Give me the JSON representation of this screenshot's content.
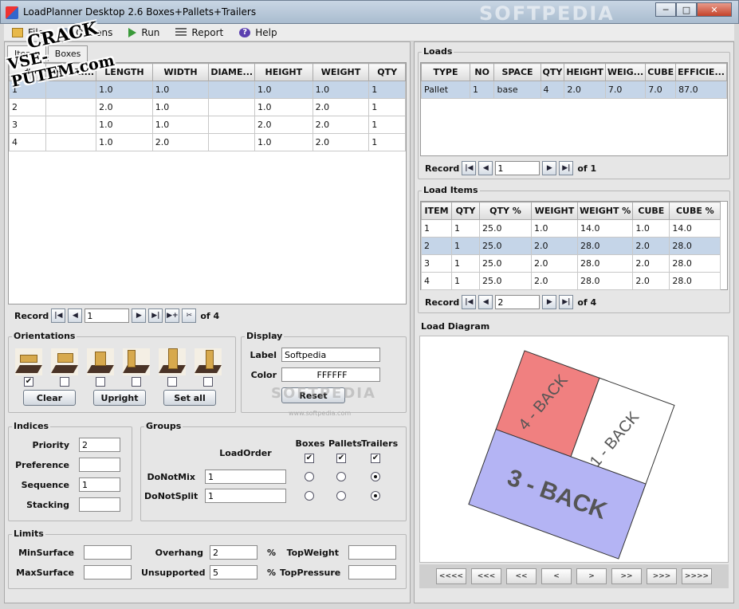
{
  "window": {
    "title": "LoadPlanner Desktop 2.6 Boxes+Pallets+Trailers",
    "watermark": "SOFTPEDIA",
    "min_label": "─",
    "max_label": "□",
    "close_label": "✕"
  },
  "overlay": {
    "line1": "CRACK",
    "line2": "VSE-PUTEM.com"
  },
  "menu": {
    "file": "File",
    "options": "Options",
    "run": "Run",
    "report": "Report",
    "help": "Help"
  },
  "left": {
    "tabs": [
      "Items",
      "Boxes"
    ],
    "items_columns": [
      "#",
      "DESCRI...",
      "LENGTH",
      "WIDTH",
      "DIAME...",
      "HEIGHT",
      "WEIGHT",
      "QTY"
    ],
    "items_rows": [
      [
        "1",
        "",
        "1.0",
        "1.0",
        "",
        "1.0",
        "1.0",
        "1"
      ],
      [
        "2",
        "",
        "2.0",
        "1.0",
        "",
        "1.0",
        "2.0",
        "1"
      ],
      [
        "3",
        "",
        "1.0",
        "1.0",
        "",
        "2.0",
        "2.0",
        "1"
      ],
      [
        "4",
        "",
        "1.0",
        "2.0",
        "",
        "1.0",
        "2.0",
        "1"
      ]
    ],
    "record": {
      "label": "Record",
      "value": "1",
      "of": "of 4"
    },
    "orientations": {
      "title": "Orientations",
      "checks": [
        true,
        false,
        false,
        false,
        false,
        false
      ],
      "clear": "Clear",
      "upright": "Upright",
      "set_all": "Set all"
    },
    "display": {
      "title": "Display",
      "label_label": "Label",
      "label_value": "Softpedia",
      "color_label": "Color",
      "color_value": "FFFFFF",
      "reset": "Reset"
    },
    "indices": {
      "title": "Indices",
      "priority_label": "Priority",
      "priority_value": "2",
      "preference_label": "Preference",
      "preference_value": "",
      "sequence_label": "Sequence",
      "sequence_value": "1",
      "stacking_label": "Stacking",
      "stacking_value": ""
    },
    "groups": {
      "title": "Groups",
      "loadorder": "LoadOrder",
      "col_boxes": "Boxes",
      "col_pallets": "Pallets",
      "col_trailers": "Trailers",
      "donotmix_label": "DoNotMix",
      "donotmix_value": "1",
      "donotsplit_label": "DoNotSplit",
      "donotsplit_value": "1",
      "checks": [
        true,
        true,
        true
      ],
      "donotmix_radio": [
        false,
        false,
        true
      ],
      "donotsplit_radio": [
        false,
        false,
        true
      ]
    },
    "limits": {
      "title": "Limits",
      "minsurface_label": "MinSurface",
      "minsurface_value": "",
      "maxsurface_label": "MaxSurface",
      "maxsurface_value": "",
      "overhang_label": "Overhang",
      "overhang_value": "2",
      "unsupported_label": "Unsupported",
      "unsupported_value": "5",
      "pct": "%",
      "topweight_label": "TopWeight",
      "topweight_value": "",
      "toppressure_label": "TopPressure",
      "toppressure_value": ""
    }
  },
  "right": {
    "loads": {
      "title": "Loads",
      "columns": [
        "TYPE",
        "NO",
        "SPACE",
        "QTY",
        "HEIGHT",
        "WEIG...",
        "CUBE",
        "EFFICIE..."
      ],
      "rows": [
        [
          "Pallet",
          "1",
          "base",
          "4",
          "2.0",
          "7.0",
          "7.0",
          "87.0"
        ]
      ],
      "record": {
        "label": "Record",
        "value": "1",
        "of": "of 1"
      }
    },
    "load_items": {
      "title": "Load Items",
      "columns": [
        "ITEM",
        "QTY",
        "QTY %",
        "WEIGHT",
        "WEIGHT %",
        "CUBE",
        "CUBE %"
      ],
      "rows": [
        [
          "1",
          "1",
          "25.0",
          "1.0",
          "14.0",
          "1.0",
          "14.0"
        ],
        [
          "2",
          "1",
          "25.0",
          "2.0",
          "28.0",
          "2.0",
          "28.0"
        ],
        [
          "3",
          "1",
          "25.0",
          "2.0",
          "28.0",
          "2.0",
          "28.0"
        ],
        [
          "4",
          "1",
          "25.0",
          "2.0",
          "28.0",
          "2.0",
          "28.0"
        ]
      ],
      "selected_row": 1,
      "record": {
        "label": "Record",
        "value": "2",
        "of": "of 4"
      }
    },
    "diagram": {
      "title": "Load Diagram",
      "box_labels": [
        "4 - BACK",
        "1 - BACK",
        "3 - BACK"
      ],
      "box_colors": [
        "#f08080",
        "#ffffff",
        "#b4b4f4"
      ],
      "watermark": "SOFTPEDIA",
      "watermark_url": "www.softpedia.com",
      "nav": [
        "<<<<",
        "<<<",
        "<<",
        "<",
        ">",
        ">>",
        ">>>",
        ">>>>"
      ]
    }
  }
}
